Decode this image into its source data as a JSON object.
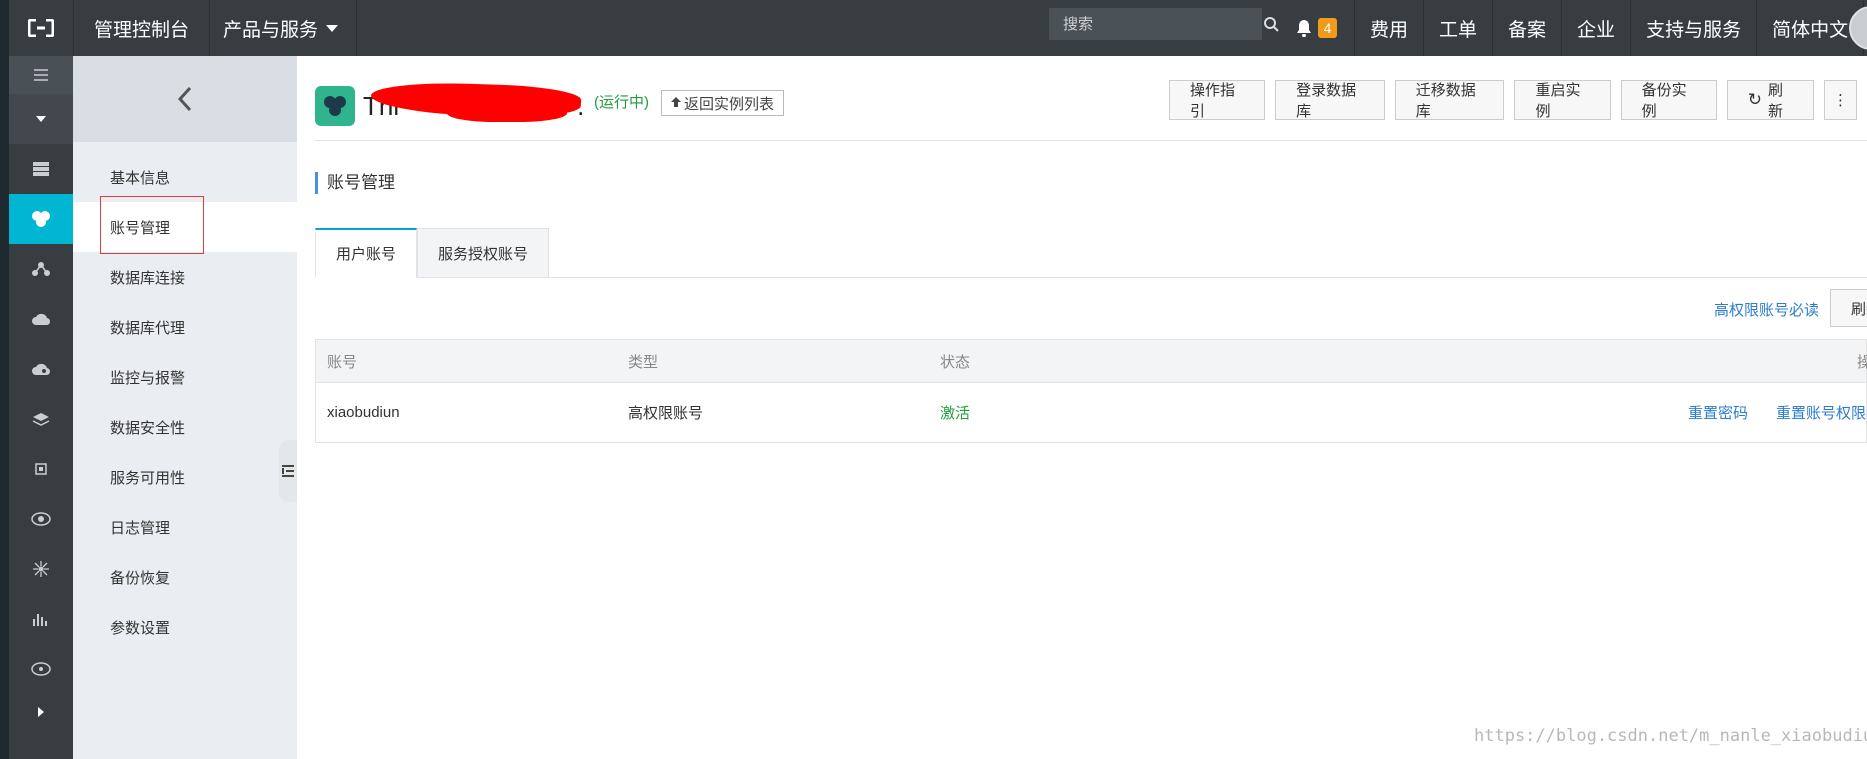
{
  "topbar": {
    "logo_icon": "aliyun-logo-icon",
    "console_label": "管理控制台",
    "products_label": "产品与服务",
    "search_placeholder": "搜索",
    "notification_count": "4",
    "nav_links": [
      "费用",
      "工单",
      "备案",
      "企业",
      "支持与服务",
      "简体中文"
    ]
  },
  "rail": {
    "icons": [
      "menu-icon",
      "caret-down-icon",
      "server-icon",
      "rds-icon",
      "network-icon",
      "cloud-upload-icon",
      "cloud-icon",
      "layers-icon",
      "chip-icon",
      "eye-icon",
      "hub-icon",
      "chart-icon",
      "eye-alt-icon",
      "expand-icon"
    ],
    "active_index": 3
  },
  "sidebar": {
    "items": [
      {
        "label": "基本信息"
      },
      {
        "label": "账号管理"
      },
      {
        "label": "数据库连接"
      },
      {
        "label": "数据库代理"
      },
      {
        "label": "监控与报警"
      },
      {
        "label": "数据安全性"
      },
      {
        "label": "服务可用性"
      },
      {
        "label": "日志管理"
      },
      {
        "label": "备份恢复"
      },
      {
        "label": "参数设置"
      }
    ],
    "active_index": 1
  },
  "header": {
    "instance_name_visible": "Thi",
    "instance_name_tail": ".",
    "status": "(运行中)",
    "back_list_label": "返回实例列表",
    "actions": [
      "操作指引",
      "登录数据库",
      "迁移数据库",
      "重启实例",
      "备份实例",
      "刷新"
    ]
  },
  "section": {
    "title": "账号管理"
  },
  "tabs": [
    {
      "label": "用户账号",
      "active": true
    },
    {
      "label": "服务授权账号",
      "active": false
    }
  ],
  "toolbar": {
    "high_priv_notice": "高权限账号必读",
    "refresh_label": "刷新"
  },
  "table": {
    "headers": [
      "账号",
      "类型",
      "状态",
      "操"
    ],
    "rows": [
      {
        "account": "xiaobudiun",
        "type": "高权限账号",
        "status": "激活",
        "actions": [
          "重置密码",
          "重置账号权限"
        ]
      }
    ]
  },
  "colors": {
    "topbar": "#373d41",
    "active_rail": "#00b6d2",
    "link": "#2c7ccf",
    "success": "#1e9e3c",
    "badge": "#f29b1a"
  },
  "watermark": "https://blog.csdn.net/m_nanle_xiaobudiu"
}
